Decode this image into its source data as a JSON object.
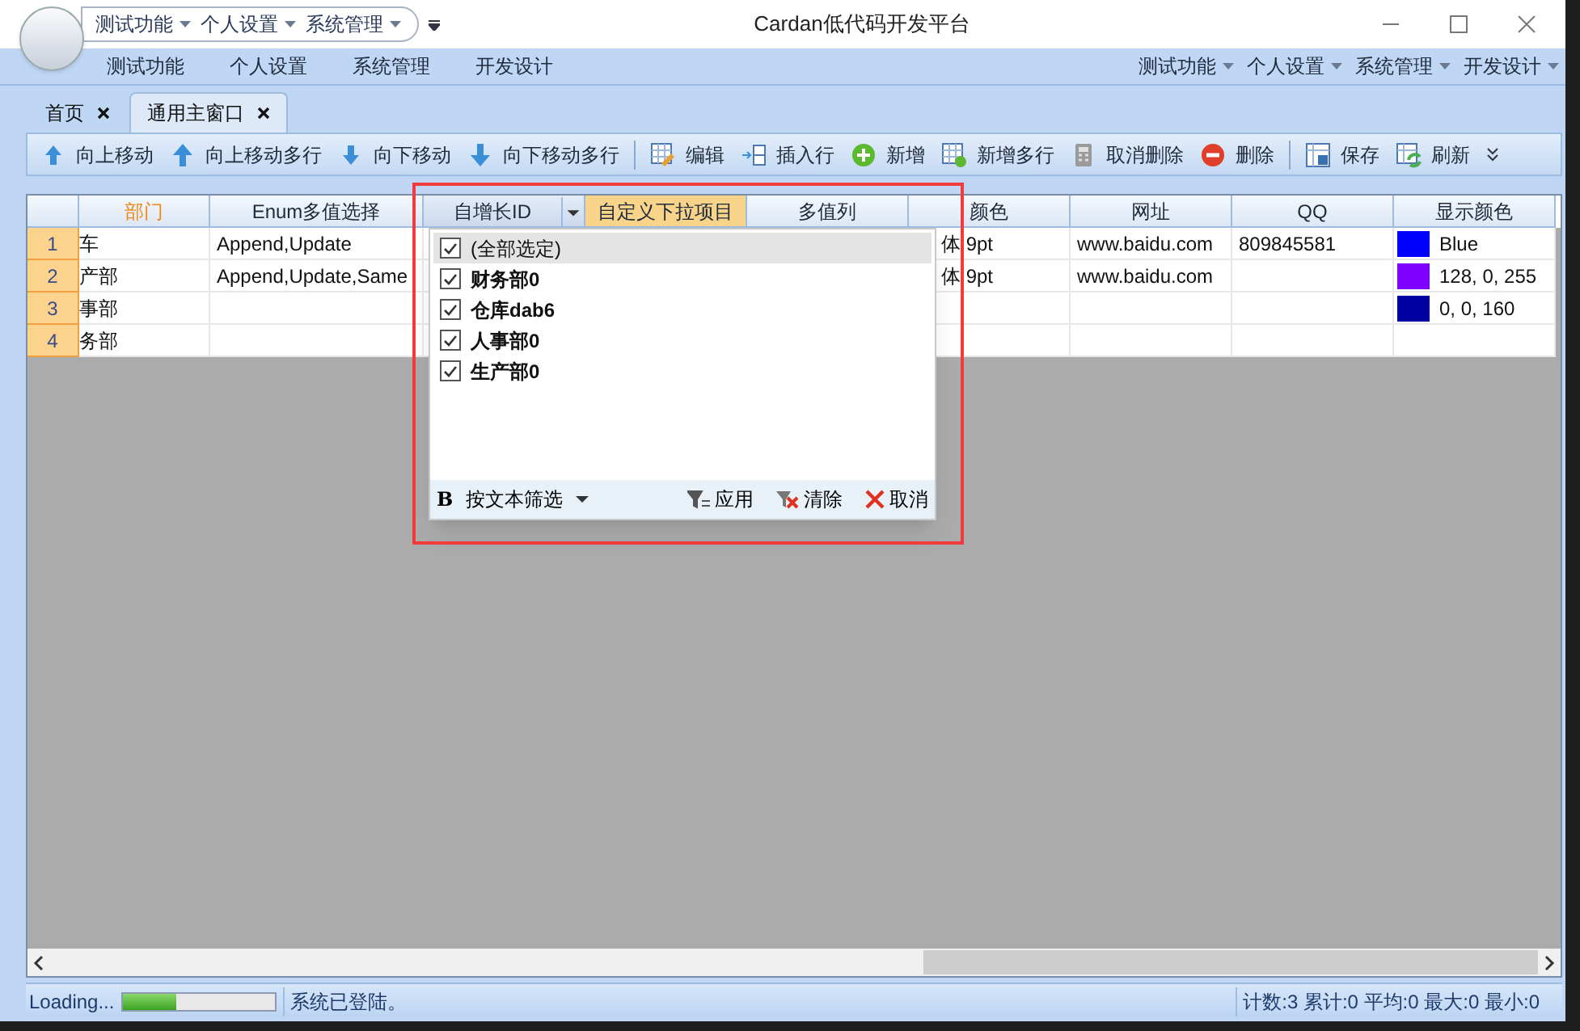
{
  "window": {
    "title": "Cardan低代码开发平台"
  },
  "quick_access": [
    {
      "label": "测试功能"
    },
    {
      "label": "个人设置"
    },
    {
      "label": "系统管理"
    }
  ],
  "ribbon_tabs": [
    {
      "label": "测试功能"
    },
    {
      "label": "个人设置"
    },
    {
      "label": "系统管理"
    },
    {
      "label": "开发设计"
    }
  ],
  "ribbon_menus": [
    {
      "label": "测试功能"
    },
    {
      "label": "个人设置"
    },
    {
      "label": "系统管理"
    },
    {
      "label": "开发设计"
    }
  ],
  "document_tabs": [
    {
      "label": "首页",
      "selected": false
    },
    {
      "label": "通用主窗口",
      "selected": true
    }
  ],
  "toolbar": [
    {
      "kind": "button",
      "label": "向上移动"
    },
    {
      "kind": "button",
      "label": "向上移动多行"
    },
    {
      "kind": "button",
      "label": "向下移动"
    },
    {
      "kind": "button",
      "label": "向下移动多行"
    },
    {
      "kind": "separator"
    },
    {
      "kind": "button",
      "label": "编辑"
    },
    {
      "kind": "button",
      "label": "插入行"
    },
    {
      "kind": "button",
      "label": "新增"
    },
    {
      "kind": "button",
      "label": "新增多行"
    },
    {
      "kind": "button",
      "label": "取消删除"
    },
    {
      "kind": "button",
      "label": "删除"
    },
    {
      "kind": "separator"
    },
    {
      "kind": "button",
      "label": "保存"
    },
    {
      "kind": "button",
      "label": "刷新"
    }
  ],
  "table": {
    "columns": [
      {
        "label": "部门",
        "kind": "sorted"
      },
      {
        "label": "Enum多值选择",
        "kind": "normal"
      },
      {
        "label": "自增长ID",
        "kind": "filter"
      },
      {
        "label": "自定义下拉项目",
        "kind": "hot"
      },
      {
        "label": "多值列",
        "kind": "normal"
      },
      {
        "label": "颜色",
        "kind": "normal"
      },
      {
        "label": "网址",
        "kind": "normal"
      },
      {
        "label": "QQ",
        "kind": "normal"
      },
      {
        "label": "显示颜色",
        "kind": "normal"
      }
    ],
    "rows": [
      {
        "number": "1",
        "department": "车",
        "enum": "Append,Update",
        "font": "体 9pt",
        "url": "www.baidu.com",
        "qq": "809845581",
        "display_color": {
          "color": "#0000ff",
          "text": "Blue"
        }
      },
      {
        "number": "2",
        "department": "产部",
        "enum": "Append,Update,Same",
        "font": "体 9pt",
        "url": "www.baidu.com",
        "display_color": {
          "color": "#8000ff",
          "text": "128, 0, 255"
        }
      },
      {
        "number": "3",
        "department": "事部",
        "display_color": {
          "color": "#0000a0",
          "text": "0, 0, 160"
        }
      },
      {
        "number": "4",
        "department": "务部"
      }
    ]
  },
  "filter_popup": {
    "items": [
      {
        "label": "(全部选定)",
        "kind": "all",
        "checked": true,
        "selected": true
      },
      {
        "label": "财务部0",
        "kind": "value",
        "checked": true,
        "selected": false
      },
      {
        "label": "仓库dab6",
        "kind": "value",
        "checked": true,
        "selected": false
      },
      {
        "label": "人事部0",
        "kind": "value",
        "checked": true,
        "selected": false
      },
      {
        "label": "生产部0",
        "kind": "value",
        "checked": true,
        "selected": false
      }
    ],
    "mode_glyph": "B",
    "mode": "按文本筛选",
    "buttons": [
      {
        "kind": "apply",
        "label": "应用"
      },
      {
        "kind": "clear",
        "label": "清除"
      },
      {
        "kind": "cancel",
        "label": "取消"
      }
    ]
  },
  "status_bar": {
    "loading": {
      "label": "Loading...",
      "level": 0.35
    },
    "message": "系统已登陆。",
    "summary": "计数:3 累计:0 平均:0 最大:0 最小:0"
  }
}
